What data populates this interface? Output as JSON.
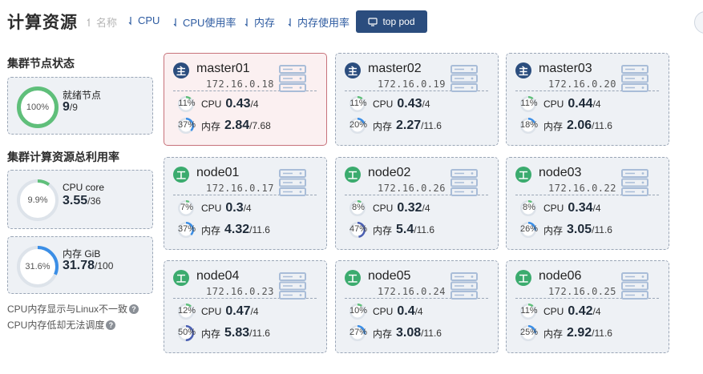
{
  "header": {
    "title": "计算资源",
    "sort": [
      {
        "label": "名称",
        "enabled": false
      },
      {
        "label": "CPU",
        "enabled": true
      },
      {
        "label": "CPU使用率",
        "enabled": true
      },
      {
        "label": "内存",
        "enabled": true
      },
      {
        "label": "内存使用率",
        "enabled": true
      }
    ],
    "top_pod_label": "top pod",
    "top_pod_icon": "monitor-icon"
  },
  "cluster_status": {
    "title": "集群节点状态",
    "ring_pct": "100%",
    "ring_fraction": 1.0,
    "ring_color": "#5fbf7a",
    "label": "就绪节点",
    "value": "9",
    "total": "/9"
  },
  "cluster_usage": {
    "title": "集群计算资源总利用率",
    "cpu": {
      "ring_pct": "9.9%",
      "ring_fraction": 0.099,
      "ring_color": "#5fbf7a",
      "label": "CPU core",
      "value": "3.55",
      "total": "/36"
    },
    "mem": {
      "ring_pct": "31.6%",
      "ring_fraction": 0.316,
      "ring_color": "#3b8ee6",
      "label": "内存 GiB",
      "value": "31.78",
      "total": "/100"
    }
  },
  "notes": [
    "CPU内存显示与Linux不一致",
    "CPU内存低却无法调度"
  ],
  "colors": {
    "master_badge": "#2b4d7e",
    "worker_badge": "#3bab6e",
    "ring_track": "#dde3ea",
    "green": "#5fbf7a",
    "blue": "#3b8ee6",
    "purple": "#4a5fb2"
  },
  "nodes": [
    {
      "badge": "主",
      "type": "master",
      "name": "master01",
      "ip": "172.16.0.18",
      "alert": true,
      "cpu": {
        "pct": "11%",
        "fraction": 0.11,
        "label": "CPU",
        "value": "0.43",
        "total": "/4"
      },
      "mem": {
        "pct": "37%",
        "fraction": 0.37,
        "label": "内存",
        "value": "2.84",
        "total": "/7.68"
      }
    },
    {
      "badge": "主",
      "type": "master",
      "name": "master02",
      "ip": "172.16.0.19",
      "alert": false,
      "cpu": {
        "pct": "11%",
        "fraction": 0.11,
        "label": "CPU",
        "value": "0.43",
        "total": "/4"
      },
      "mem": {
        "pct": "20%",
        "fraction": 0.2,
        "label": "内存",
        "value": "2.27",
        "total": "/11.6"
      }
    },
    {
      "badge": "主",
      "type": "master",
      "name": "master03",
      "ip": "172.16.0.20",
      "alert": false,
      "cpu": {
        "pct": "11%",
        "fraction": 0.11,
        "label": "CPU",
        "value": "0.44",
        "total": "/4"
      },
      "mem": {
        "pct": "18%",
        "fraction": 0.18,
        "label": "内存",
        "value": "2.06",
        "total": "/11.6"
      }
    },
    {
      "badge": "工",
      "type": "worker",
      "name": "node01",
      "ip": "172.16.0.17",
      "alert": false,
      "cpu": {
        "pct": "7%",
        "fraction": 0.07,
        "label": "CPU",
        "value": "0.3",
        "total": "/4"
      },
      "mem": {
        "pct": "37%",
        "fraction": 0.37,
        "label": "内存",
        "value": "4.32",
        "total": "/11.6"
      }
    },
    {
      "badge": "工",
      "type": "worker",
      "name": "node02",
      "ip": "172.16.0.26",
      "alert": false,
      "cpu": {
        "pct": "8%",
        "fraction": 0.08,
        "label": "CPU",
        "value": "0.32",
        "total": "/4"
      },
      "mem": {
        "pct": "47%",
        "fraction": 0.47,
        "label": "内存",
        "value": "5.4",
        "total": "/11.6"
      }
    },
    {
      "badge": "工",
      "type": "worker",
      "name": "node03",
      "ip": "172.16.0.22",
      "alert": false,
      "cpu": {
        "pct": "8%",
        "fraction": 0.08,
        "label": "CPU",
        "value": "0.34",
        "total": "/4"
      },
      "mem": {
        "pct": "26%",
        "fraction": 0.26,
        "label": "内存",
        "value": "3.05",
        "total": "/11.6"
      }
    },
    {
      "badge": "工",
      "type": "worker",
      "name": "node04",
      "ip": "172.16.0.23",
      "alert": false,
      "cpu": {
        "pct": "12%",
        "fraction": 0.12,
        "label": "CPU",
        "value": "0.47",
        "total": "/4"
      },
      "mem": {
        "pct": "50%",
        "fraction": 0.5,
        "label": "内存",
        "value": "5.83",
        "total": "/11.6"
      }
    },
    {
      "badge": "工",
      "type": "worker",
      "name": "node05",
      "ip": "172.16.0.24",
      "alert": false,
      "cpu": {
        "pct": "10%",
        "fraction": 0.1,
        "label": "CPU",
        "value": "0.4",
        "total": "/4"
      },
      "mem": {
        "pct": "27%",
        "fraction": 0.27,
        "label": "内存",
        "value": "3.08",
        "total": "/11.6"
      }
    },
    {
      "badge": "工",
      "type": "worker",
      "name": "node06",
      "ip": "172.16.0.25",
      "alert": false,
      "cpu": {
        "pct": "11%",
        "fraction": 0.11,
        "label": "CPU",
        "value": "0.42",
        "total": "/4"
      },
      "mem": {
        "pct": "25%",
        "fraction": 0.25,
        "label": "内存",
        "value": "2.92",
        "total": "/11.6"
      }
    }
  ]
}
